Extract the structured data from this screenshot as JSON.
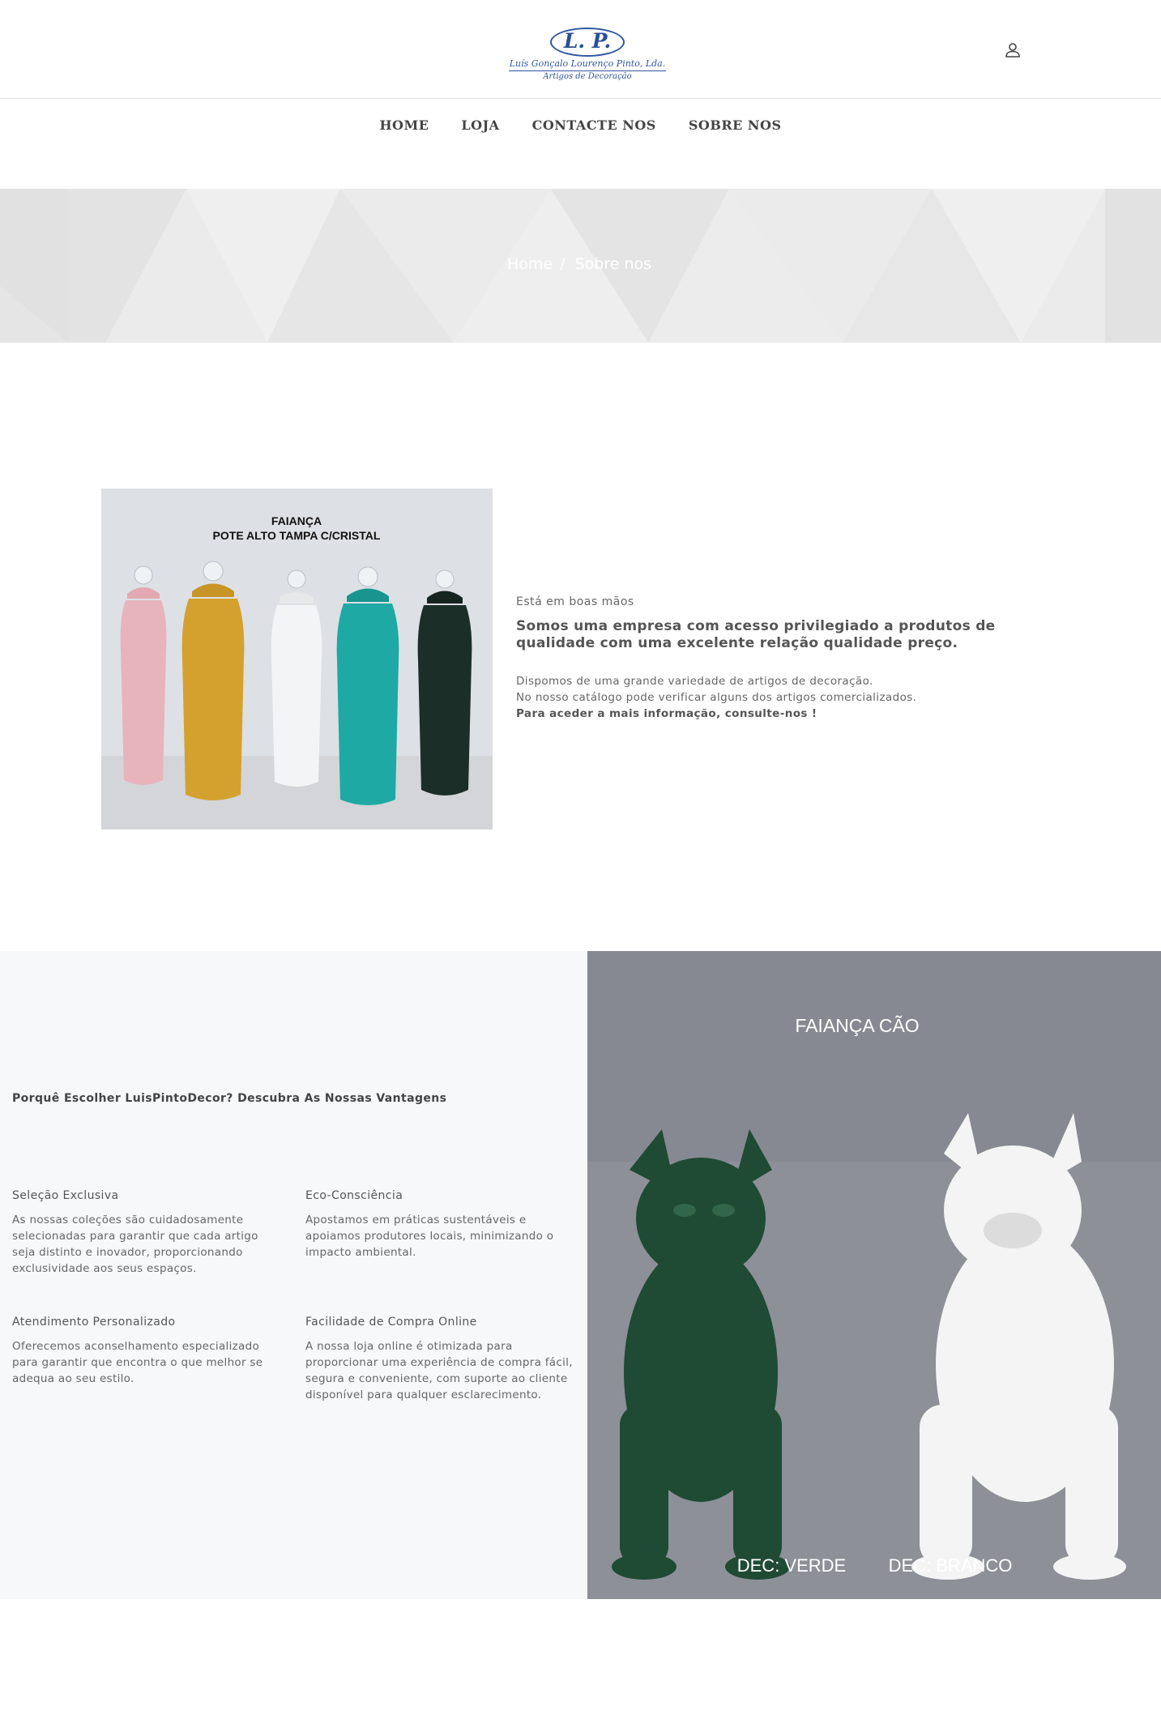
{
  "header": {
    "logo": {
      "initials": "L. P.",
      "company": "Luís Gonçalo Lourenço Pinto, Lda.",
      "tagline": "Artigos de Decoração"
    },
    "account_icon": "user-icon"
  },
  "nav": {
    "items": [
      {
        "label": "HOME"
      },
      {
        "label": "LOJA"
      },
      {
        "label": "CONTACTE NOS"
      },
      {
        "label": "SOBRE NOS"
      }
    ]
  },
  "breadcrumb": {
    "home": "Home",
    "separator": "/",
    "current": "Sobre nos"
  },
  "about": {
    "image_caption_line1": "FAIANÇA",
    "image_caption_line2": "POTE ALTO TAMPA C/CRISTAL",
    "eyebrow": "Está em boas mãos",
    "headline": "Somos uma empresa com acesso privilegiado a produtos de qualidade com uma excelente relação qualidade preço.",
    "line1": "Dispomos de uma grande variedade de artigos de decoração.",
    "line2": "No nosso catálogo pode verificar alguns dos artigos comercializados.",
    "line3": "Para aceder a mais informação, consulte-nos !"
  },
  "advantages": {
    "title": "Porquê Escolher LuisPintoDecor? Descubra As Nossas Vantagens",
    "features": [
      {
        "title": "Seleção Exclusiva",
        "desc": "As nossas coleções são cuidadosamente selecionadas para garantir que cada artigo seja distinto e inovador, proporcionando exclusividade aos seus espaços."
      },
      {
        "title": "Eco-Consciência",
        "desc": "Apostamos em práticas sustentáveis e apoiamos produtores locais, minimizando o impacto ambiental."
      },
      {
        "title": "Atendimento Personalizado",
        "desc": "Oferecemos aconselhamento especializado para garantir que encontra o que melhor se adequa ao seu estilo."
      },
      {
        "title": "Facilidade de Compra Online",
        "desc": "A nossa loja online é otimizada para proporcionar uma experiência de compra fácil, segura e conveniente, com suporte ao cliente disponível para qualquer esclarecimento."
      }
    ]
  },
  "dog_image": {
    "caption_title": "FAIANÇA CÃO",
    "caption_left": "DEC: VERDE",
    "caption_right": "DEC: BRANCO"
  },
  "colors": {
    "logo_blue": "#2f56a0",
    "hero_bg": "#e8e8e9",
    "section_bg": "#f7f8fa",
    "vase_pink": "#e8b4bc",
    "vase_mustard": "#d4a12e",
    "vase_white": "#eef0f2",
    "vase_teal": "#1ea9a4",
    "vase_dark_green": "#1c2e28",
    "dog_green": "#1f4a34",
    "dog_white": "#f4f4f4"
  }
}
